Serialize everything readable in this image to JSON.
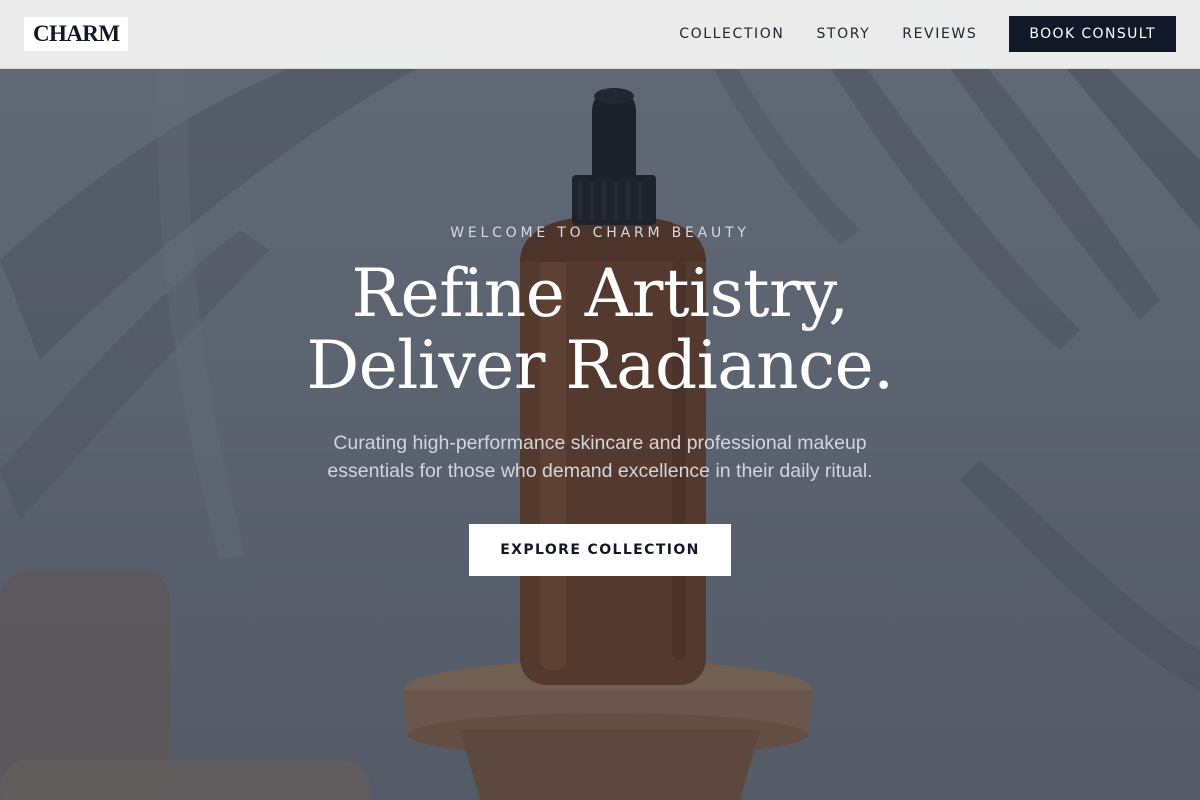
{
  "header": {
    "logo": "CHARM",
    "nav": [
      "COLLECTION",
      "STORY",
      "REVIEWS"
    ],
    "cta_label": "BOOK CONSULT"
  },
  "hero": {
    "eyebrow": "WELCOME TO CHARM BEAUTY",
    "headline_line1": "Refine Artistry,",
    "headline_line2": "Deliver Radiance.",
    "subtext_line1": "Curating high-performance skincare and professional makeup",
    "subtext_line2": "essentials for those who demand excellence in their daily ritual.",
    "cta_label": "EXPLORE COLLECTION"
  },
  "colors": {
    "header_bg": "#f0f0f0",
    "accent_dark": "#111827",
    "overlay": "#232a3a",
    "bottle_amber": "#8a4a22"
  },
  "icons": {
    "hero_image": "amber-serum-bottle-on-wooden-pedestal"
  }
}
